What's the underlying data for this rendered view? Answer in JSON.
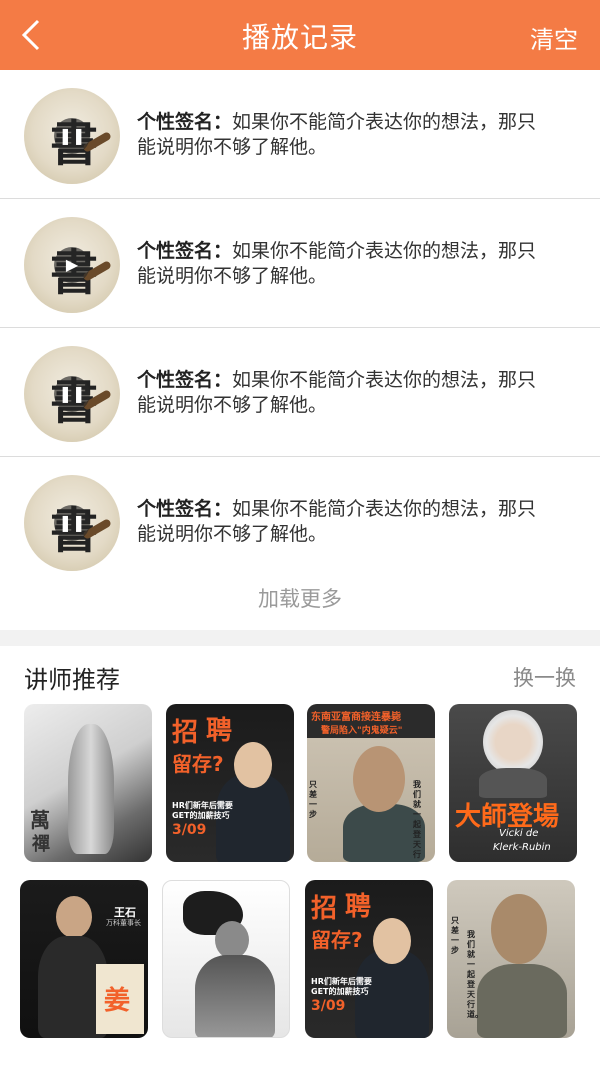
{
  "header": {
    "title": "播放记录",
    "clear_label": "清空",
    "back_icon": "chevron-left-icon"
  },
  "records": [
    {
      "label": "个性签名：",
      "text": "如果你不能简介表达你的想法，那只能说明你不够了解他。",
      "avatar_char": "書",
      "play_state": "pause"
    },
    {
      "label": "个性签名：",
      "text": "如果你不能简介表达你的想法，那只能说明你不够了解他。",
      "avatar_char": "書",
      "play_state": "play"
    },
    {
      "label": "个性签名：",
      "text": "如果你不能简介表达你的想法，那只能说明你不够了解他。",
      "avatar_char": "書",
      "play_state": "pause"
    },
    {
      "label": "个性签名：",
      "text": "如果你不能简介表达你的想法，那只能说明你不够了解他。",
      "avatar_char": "書",
      "play_state": "pause"
    }
  ],
  "load_more": "加载更多",
  "recommend": {
    "title": "讲师推荐",
    "swap_label": "换一换",
    "cards": [
      {
        "lines": [
          "萬",
          "禪"
        ]
      },
      {
        "lines": [
          "招",
          "聘",
          "留存?",
          "HR们新年后需要",
          "GET的加薪技巧",
          "3/09"
        ]
      },
      {
        "lines": [
          "东南亚富商接连暴毙",
          "警局陷入\"内鬼疑云\"",
          "只差一步",
          "我们就一起登天行"
        ]
      },
      {
        "lines": [
          "大師登場",
          "Vicki de",
          "Klerk-Rubin"
        ]
      },
      {
        "lines": [
          "王石",
          "万科董事长",
          "姜"
        ]
      },
      {
        "lines": []
      },
      {
        "lines": [
          "招",
          "聘",
          "留存?",
          "HR们新年后需要",
          "GET的加薪技巧",
          "3/09"
        ]
      },
      {
        "lines": [
          "只差一步",
          "我们就一起登天行道。"
        ]
      }
    ]
  },
  "colors": {
    "accent": "#f47b45",
    "divider": "#dcdcdc",
    "muted_text": "#9a9a9a"
  }
}
